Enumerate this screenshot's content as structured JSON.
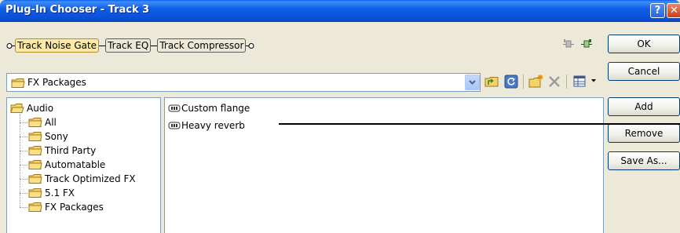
{
  "window": {
    "title": "Plug-In Chooser - Track 3",
    "help_label": "?",
    "close_label": "✕"
  },
  "chain": {
    "plugins": [
      "Track Noise Gate",
      "Track EQ",
      "Track Compressor"
    ],
    "active_index": 0
  },
  "buttons": {
    "ok": "OK",
    "cancel": "Cancel",
    "add": "Add",
    "remove": "Remove",
    "save_as": "Save As..."
  },
  "location": {
    "value": "FX Packages"
  },
  "tree": {
    "root": "Audio",
    "children": [
      "All",
      "Sony",
      "Third Party",
      "Automatable",
      "Track Optimized FX",
      "5.1 FX",
      "FX Packages"
    ]
  },
  "list": {
    "items": [
      "Custom flange",
      "Heavy reverb"
    ]
  },
  "colors": {
    "title_bar": "#0a4fd8",
    "dialog_bg": "#ece9d8",
    "active_plugin": "#fde9a8",
    "folder": "#f5d36b"
  }
}
